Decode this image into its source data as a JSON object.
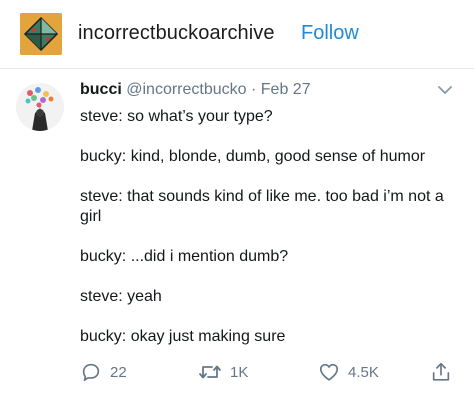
{
  "blog": {
    "name": "incorrectbuckoarchive",
    "follow_label": "Follow"
  },
  "tweet": {
    "display_name": "bucci",
    "handle": "@incorrectbucko",
    "separator": "·",
    "date": "Feb 27",
    "lines": [
      "steve: so what’s your type?",
      "bucky: kind, blonde, dumb, good sense of humor",
      "steve: that sounds kind of like me. too bad i’m not a girl",
      "bucky: ...did i mention dumb?",
      "steve: yeah",
      "bucky: okay just making sure"
    ],
    "reply_count": "22",
    "retweet_count": "1K",
    "like_count": "4.5K"
  },
  "icons": {
    "caret": "chevron-down-icon",
    "reply": "comment-icon",
    "retweet": "retweet-icon",
    "like": "heart-icon",
    "share": "share-icon"
  },
  "colors": {
    "follow": "#1f8bd8",
    "secondary_text": "#657786",
    "avatar_bg": "#e3a43b"
  }
}
